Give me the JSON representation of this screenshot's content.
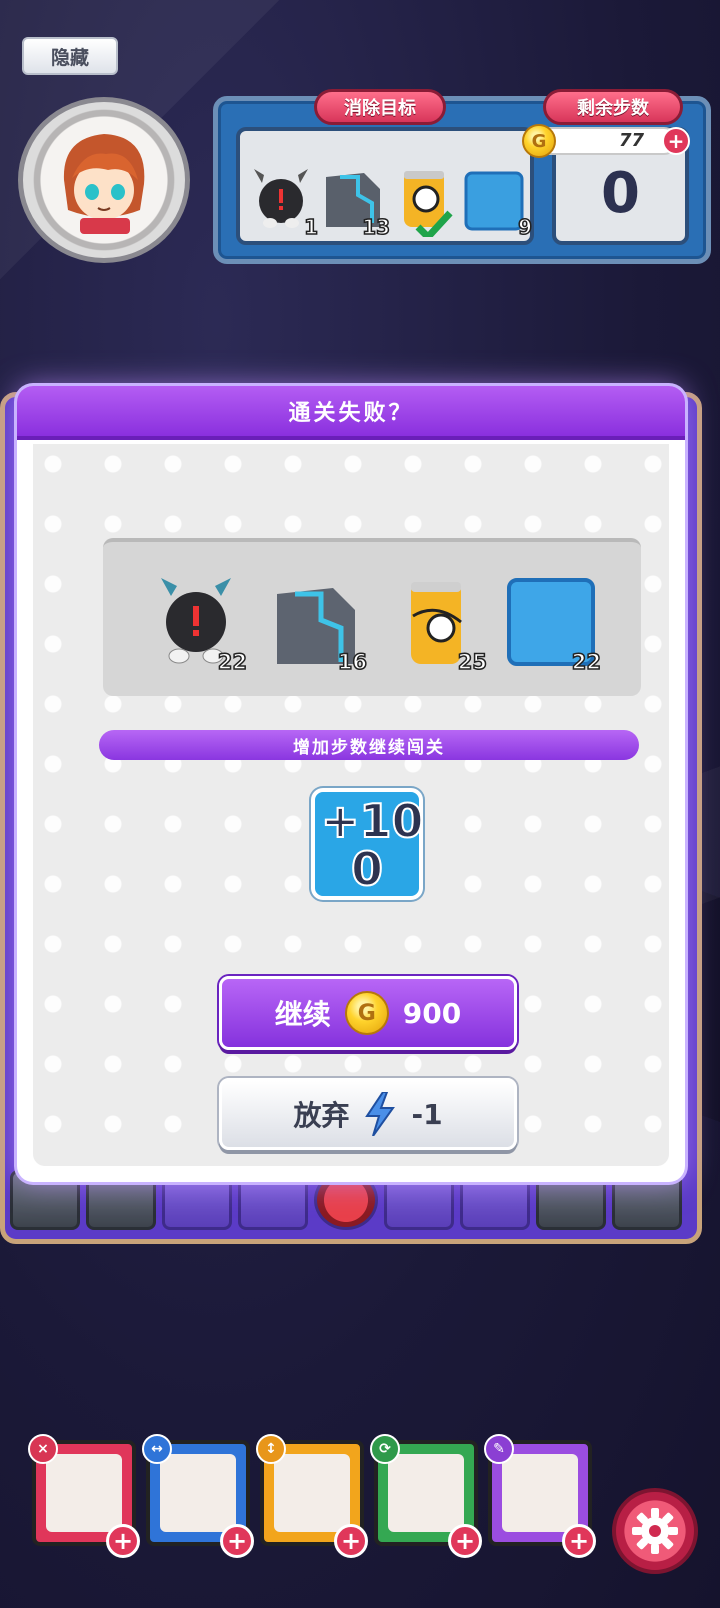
{
  "hud": {
    "hide_label": "隐藏",
    "goal_label": "消除目标",
    "steps_label": "剩余步数",
    "coins": "77",
    "steps_remaining": "0",
    "goals": [
      {
        "icon": "bomb-robot-icon",
        "count": "1"
      },
      {
        "icon": "metal-block-icon",
        "count": "13"
      },
      {
        "icon": "soda-can-icon",
        "count": "",
        "done": true
      },
      {
        "icon": "ice-tile-icon",
        "count": "9"
      }
    ]
  },
  "modal": {
    "title": "通关失败？",
    "results": [
      {
        "icon": "bomb-robot-icon",
        "count": "22"
      },
      {
        "icon": "metal-block-icon",
        "count": "16"
      },
      {
        "icon": "soda-can-icon",
        "count": "25"
      },
      {
        "icon": "ice-tile-icon",
        "count": "22"
      }
    ],
    "banner": "增加步数继续闯关",
    "plus_steps_line1": "+10",
    "plus_steps_line2": "0",
    "continue_label": "继续",
    "continue_cost": "900",
    "giveup_label": "放弃",
    "giveup_cost": "-1"
  },
  "colors": {
    "accent_purple": "#8a36e0",
    "tag_red": "#d8355a",
    "panel_blue": "#2a6fb5"
  }
}
